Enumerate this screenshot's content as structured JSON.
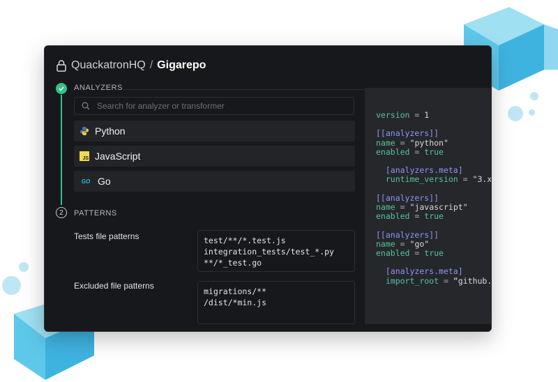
{
  "repo": {
    "org": "QuackatronHQ",
    "separator": "/",
    "name": "Gigarepo"
  },
  "analyzers_section": {
    "label": "ANALYZERS",
    "search_placeholder": "Search for analyzer or transformer",
    "items": [
      {
        "label": "Python",
        "icon": "python-icon"
      },
      {
        "label": "JavaScript",
        "icon": "javascript-icon",
        "badge": "JS"
      },
      {
        "label": "Go",
        "icon": "go-icon",
        "badge": "GO"
      }
    ]
  },
  "patterns_section": {
    "step": "2",
    "label": "PATTERNS",
    "test_label": "Tests file patterns",
    "test_patterns": [
      "test/**/*.test.js",
      "integration_tests/test_*.py",
      "**/*_test.go"
    ],
    "excluded_label": "Excluded file patterns",
    "excluded_patterns": [
      "migrations/**",
      "/dist/*min.js"
    ]
  },
  "config": {
    "version_key": "version",
    "version_value": "1",
    "analyzers_header": "[[analyzers]]",
    "meta_header": "[analyzers.meta]",
    "name_key": "name",
    "enabled_key": "enabled",
    "true_value": "true",
    "eq": "=",
    "python_name": "\"python\"",
    "runtime_key": "runtime_version",
    "runtime_value": "\"3.x",
    "javascript_name": "\"javascript\"",
    "go_name": "\"go\"",
    "import_key": "import_root",
    "import_value": "“github."
  },
  "colors": {
    "accent": "#33c28a",
    "background": "#17181b",
    "code_key": "#57c39c",
    "code_section": "#8f96f2"
  }
}
